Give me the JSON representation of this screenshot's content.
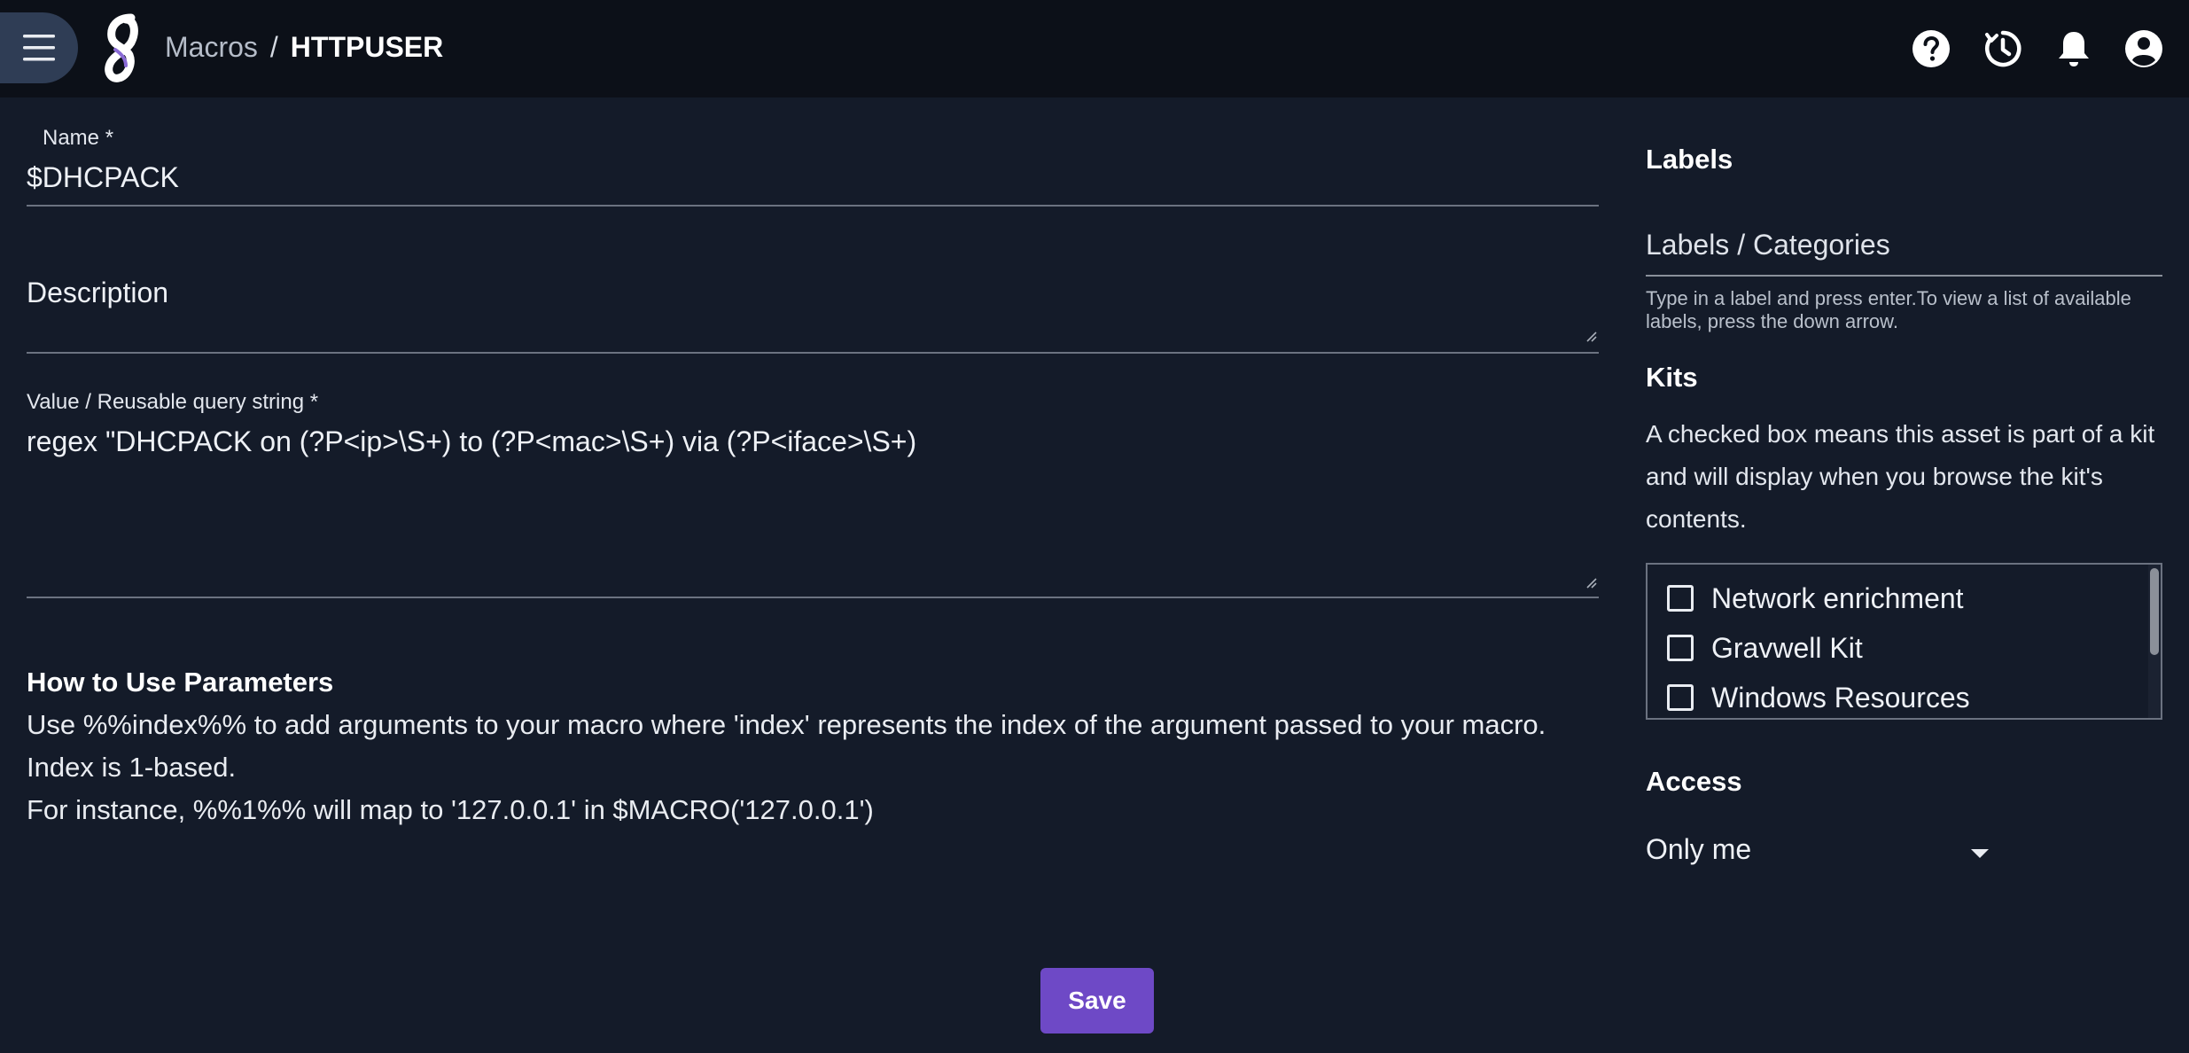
{
  "colors": {
    "background": "#141b29",
    "topbar": "#0c1018",
    "accent": "#6e49c6",
    "menu_button": "#2f3d55"
  },
  "header": {
    "menu_icon": "hamburger-menu-icon",
    "logo_icon": "gravwell-logo-icon",
    "breadcrumb": {
      "parent": "Macros",
      "separator": "/",
      "current": "HTTPUSER"
    },
    "icons": [
      "help-icon",
      "history-icon",
      "notifications-bell-icon",
      "account-icon"
    ]
  },
  "form": {
    "name": {
      "label": "Name *",
      "value": "$DHCPACK"
    },
    "description": {
      "label": "Description",
      "value": ""
    },
    "query": {
      "label": "Value / Reusable query string *",
      "value": "regex \"DHCPACK on (?P<ip>\\S+) to (?P<mac>\\S+) via (?P<iface>\\S+)"
    },
    "help": {
      "title": "How to Use Parameters",
      "lines": [
        "Use %%index%% to add arguments to your macro where 'index' represents the index of the argument passed to your macro.",
        "Index is 1-based.",
        "For instance, %%1%% will map to '127.0.0.1' in $MACRO('127.0.0.1')"
      ]
    },
    "save_label": "Save"
  },
  "sidebar": {
    "labels": {
      "title": "Labels",
      "placeholder": "Labels / Categories",
      "hint": "Type in a label and press enter.To view a list of available labels, press the down arrow."
    },
    "kits": {
      "title": "Kits",
      "description": "A checked box means this asset is part of a kit and will display when you browse the kit's contents.",
      "items": [
        {
          "label": "Network enrichment",
          "checked": false
        },
        {
          "label": "Gravwell Kit",
          "checked": false
        },
        {
          "label": "Windows Resources",
          "checked": false
        }
      ]
    },
    "access": {
      "title": "Access",
      "selected": "Only me"
    }
  }
}
